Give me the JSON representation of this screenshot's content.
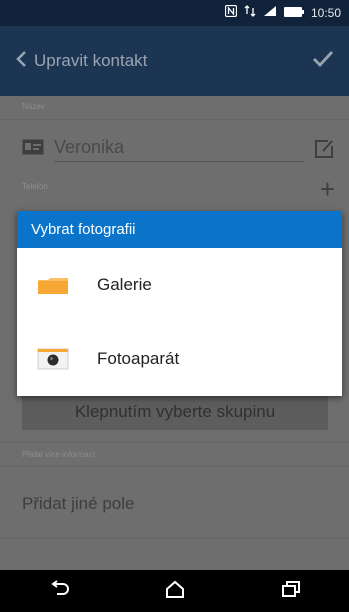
{
  "status_bar": {
    "time": "10:50",
    "icons": [
      "nfc-icon",
      "sync-icon",
      "signal-icon",
      "battery-icon"
    ]
  },
  "action_bar": {
    "back_icon": "back-chevron-icon",
    "title": "Upravit kontakt",
    "confirm_icon": "checkmark-icon"
  },
  "form": {
    "name_label": "Název",
    "contact_card_icon": "contact-card-icon",
    "name_value": "Veronika",
    "edit_icon": "edit-icon",
    "phone_label": "Telefon",
    "add_phone_symbol": "+",
    "group_button_label": "Klepnutím vyberte skupinu",
    "more_info_label": "Přidat více informací",
    "add_field_label": "Přidat jiné pole"
  },
  "dialog": {
    "title": "Vybrat fotografii",
    "options": [
      {
        "label": "Galerie",
        "icon": "gallery-folder-icon"
      },
      {
        "label": "Fotoaparát",
        "icon": "camera-icon"
      }
    ],
    "header_color": "#0a74cb"
  },
  "nav_bar": {
    "icons": [
      "back-icon",
      "home-icon",
      "recent-apps-icon"
    ]
  }
}
